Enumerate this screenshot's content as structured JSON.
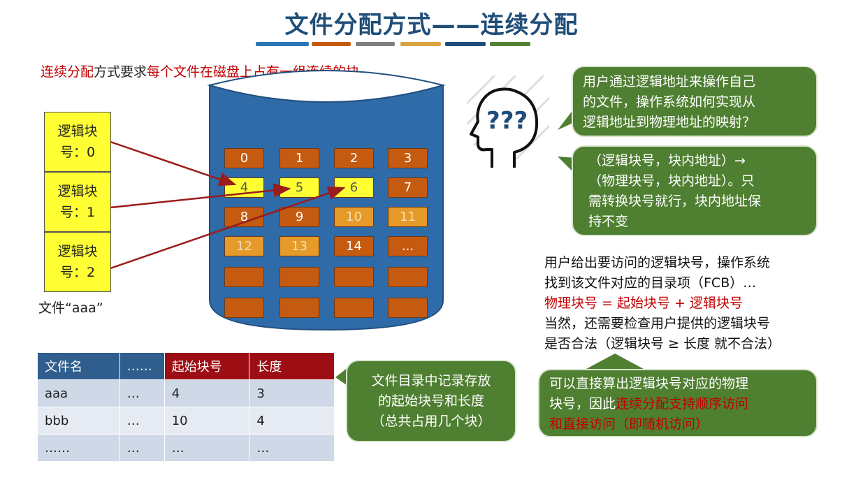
{
  "title": "文件分配方式——连续分配",
  "title_bar_colors": [
    "#2e75b6",
    "#c55a11",
    "#7f7f7f",
    "#d9a441",
    "#1f4e79",
    "#548235"
  ],
  "intro": {
    "prefix": "连续分配",
    "middle": "方式要求",
    "emphasis": "每个文件在磁盘上占有一组连续的块。"
  },
  "logical_blocks": [
    {
      "line1": "逻辑块",
      "line2": "号：0"
    },
    {
      "line1": "逻辑块",
      "line2": "号：1"
    },
    {
      "line1": "逻辑块",
      "line2": "号：2"
    }
  ],
  "file_label": "文件“aaa”",
  "disk_cells": [
    {
      "label": "0",
      "state": "occ"
    },
    {
      "label": "1",
      "state": "occ"
    },
    {
      "label": "2",
      "state": "occ"
    },
    {
      "label": "3",
      "state": "occ"
    },
    {
      "label": "4",
      "state": "sel"
    },
    {
      "label": "5",
      "state": "sel"
    },
    {
      "label": "6",
      "state": "sel"
    },
    {
      "label": "7",
      "state": "occ"
    },
    {
      "label": "8",
      "state": "occ"
    },
    {
      "label": "9",
      "state": "occ"
    },
    {
      "label": "10",
      "state": "dim"
    },
    {
      "label": "11",
      "state": "dim"
    },
    {
      "label": "12",
      "state": "dim"
    },
    {
      "label": "13",
      "state": "dim"
    },
    {
      "label": "14",
      "state": "occ"
    },
    {
      "label": "...",
      "state": "occ"
    },
    {
      "label": "",
      "state": "occ"
    },
    {
      "label": "",
      "state": "occ"
    },
    {
      "label": "",
      "state": "occ"
    },
    {
      "label": "",
      "state": "occ"
    },
    {
      "label": "",
      "state": "occ"
    },
    {
      "label": "",
      "state": "occ"
    },
    {
      "label": "",
      "state": "occ"
    },
    {
      "label": "",
      "state": "occ"
    }
  ],
  "directory_table": {
    "headers": [
      "文件名",
      "……",
      "起始块号",
      "长度"
    ],
    "rows": [
      [
        "aaa",
        "…",
        "4",
        "3"
      ],
      [
        "bbb",
        "…",
        "10",
        "4"
      ],
      [
        "……",
        "…",
        "…",
        "…"
      ]
    ]
  },
  "bubble_question": [
    "用户通过逻辑地址来操作自己",
    "的文件，操作系统如何实现从",
    "逻辑地址到物理地址的映射？"
  ],
  "bubble_answer": [
    "（逻辑块号，块内地址）→",
    "（物理块号，块内地址）。只",
    "需转换块号就行，块内地址保",
    "持不变"
  ],
  "bubble_table_note": [
    "文件目录中记录存放",
    "的起始块号和长度",
    "（总共占用几个块）"
  ],
  "note": {
    "line1": "用户给出要访问的逻辑块号，操作系统",
    "line2": "找到该文件对应的目录项（FCB）…",
    "formula": "物理块号 = 起始块号 + 逻辑块号",
    "line4": "当然，还需要检查用户提供的逻辑块号",
    "line5": "是否合法（逻辑块号 ≥ 长度 就不合法）"
  },
  "bubble_conclusion": {
    "line1": "可以直接算出逻辑块号对应的物理",
    "line2_prefix": "块号，因此",
    "line2_red": "连续分配支持顺序访问",
    "line3_red": "和直接访问（即随机访问）"
  },
  "icons": {
    "thinking_head": "thinking-head-icon"
  }
}
